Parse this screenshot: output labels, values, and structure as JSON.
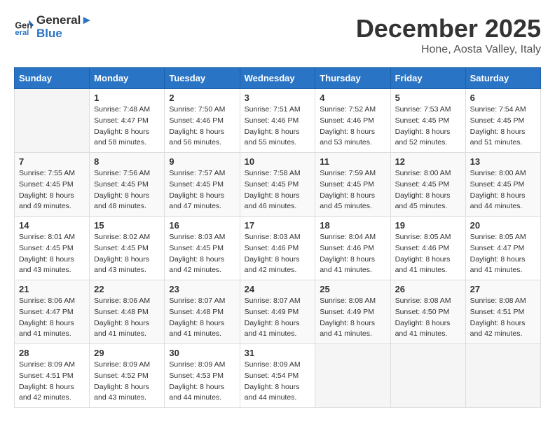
{
  "header": {
    "logo_line1": "General",
    "logo_line2": "Blue",
    "month": "December 2025",
    "location": "Hone, Aosta Valley, Italy"
  },
  "weekdays": [
    "Sunday",
    "Monday",
    "Tuesday",
    "Wednesday",
    "Thursday",
    "Friday",
    "Saturday"
  ],
  "weeks": [
    [
      {
        "day": "",
        "sunrise": "",
        "sunset": "",
        "daylight": ""
      },
      {
        "day": "1",
        "sunrise": "Sunrise: 7:48 AM",
        "sunset": "Sunset: 4:47 PM",
        "daylight": "Daylight: 8 hours and 58 minutes."
      },
      {
        "day": "2",
        "sunrise": "Sunrise: 7:50 AM",
        "sunset": "Sunset: 4:46 PM",
        "daylight": "Daylight: 8 hours and 56 minutes."
      },
      {
        "day": "3",
        "sunrise": "Sunrise: 7:51 AM",
        "sunset": "Sunset: 4:46 PM",
        "daylight": "Daylight: 8 hours and 55 minutes."
      },
      {
        "day": "4",
        "sunrise": "Sunrise: 7:52 AM",
        "sunset": "Sunset: 4:46 PM",
        "daylight": "Daylight: 8 hours and 53 minutes."
      },
      {
        "day": "5",
        "sunrise": "Sunrise: 7:53 AM",
        "sunset": "Sunset: 4:45 PM",
        "daylight": "Daylight: 8 hours and 52 minutes."
      },
      {
        "day": "6",
        "sunrise": "Sunrise: 7:54 AM",
        "sunset": "Sunset: 4:45 PM",
        "daylight": "Daylight: 8 hours and 51 minutes."
      }
    ],
    [
      {
        "day": "7",
        "sunrise": "Sunrise: 7:55 AM",
        "sunset": "Sunset: 4:45 PM",
        "daylight": "Daylight: 8 hours and 49 minutes."
      },
      {
        "day": "8",
        "sunrise": "Sunrise: 7:56 AM",
        "sunset": "Sunset: 4:45 PM",
        "daylight": "Daylight: 8 hours and 48 minutes."
      },
      {
        "day": "9",
        "sunrise": "Sunrise: 7:57 AM",
        "sunset": "Sunset: 4:45 PM",
        "daylight": "Daylight: 8 hours and 47 minutes."
      },
      {
        "day": "10",
        "sunrise": "Sunrise: 7:58 AM",
        "sunset": "Sunset: 4:45 PM",
        "daylight": "Daylight: 8 hours and 46 minutes."
      },
      {
        "day": "11",
        "sunrise": "Sunrise: 7:59 AM",
        "sunset": "Sunset: 4:45 PM",
        "daylight": "Daylight: 8 hours and 45 minutes."
      },
      {
        "day": "12",
        "sunrise": "Sunrise: 8:00 AM",
        "sunset": "Sunset: 4:45 PM",
        "daylight": "Daylight: 8 hours and 45 minutes."
      },
      {
        "day": "13",
        "sunrise": "Sunrise: 8:00 AM",
        "sunset": "Sunset: 4:45 PM",
        "daylight": "Daylight: 8 hours and 44 minutes."
      }
    ],
    [
      {
        "day": "14",
        "sunrise": "Sunrise: 8:01 AM",
        "sunset": "Sunset: 4:45 PM",
        "daylight": "Daylight: 8 hours and 43 minutes."
      },
      {
        "day": "15",
        "sunrise": "Sunrise: 8:02 AM",
        "sunset": "Sunset: 4:45 PM",
        "daylight": "Daylight: 8 hours and 43 minutes."
      },
      {
        "day": "16",
        "sunrise": "Sunrise: 8:03 AM",
        "sunset": "Sunset: 4:45 PM",
        "daylight": "Daylight: 8 hours and 42 minutes."
      },
      {
        "day": "17",
        "sunrise": "Sunrise: 8:03 AM",
        "sunset": "Sunset: 4:46 PM",
        "daylight": "Daylight: 8 hours and 42 minutes."
      },
      {
        "day": "18",
        "sunrise": "Sunrise: 8:04 AM",
        "sunset": "Sunset: 4:46 PM",
        "daylight": "Daylight: 8 hours and 41 minutes."
      },
      {
        "day": "19",
        "sunrise": "Sunrise: 8:05 AM",
        "sunset": "Sunset: 4:46 PM",
        "daylight": "Daylight: 8 hours and 41 minutes."
      },
      {
        "day": "20",
        "sunrise": "Sunrise: 8:05 AM",
        "sunset": "Sunset: 4:47 PM",
        "daylight": "Daylight: 8 hours and 41 minutes."
      }
    ],
    [
      {
        "day": "21",
        "sunrise": "Sunrise: 8:06 AM",
        "sunset": "Sunset: 4:47 PM",
        "daylight": "Daylight: 8 hours and 41 minutes."
      },
      {
        "day": "22",
        "sunrise": "Sunrise: 8:06 AM",
        "sunset": "Sunset: 4:48 PM",
        "daylight": "Daylight: 8 hours and 41 minutes."
      },
      {
        "day": "23",
        "sunrise": "Sunrise: 8:07 AM",
        "sunset": "Sunset: 4:48 PM",
        "daylight": "Daylight: 8 hours and 41 minutes."
      },
      {
        "day": "24",
        "sunrise": "Sunrise: 8:07 AM",
        "sunset": "Sunset: 4:49 PM",
        "daylight": "Daylight: 8 hours and 41 minutes."
      },
      {
        "day": "25",
        "sunrise": "Sunrise: 8:08 AM",
        "sunset": "Sunset: 4:49 PM",
        "daylight": "Daylight: 8 hours and 41 minutes."
      },
      {
        "day": "26",
        "sunrise": "Sunrise: 8:08 AM",
        "sunset": "Sunset: 4:50 PM",
        "daylight": "Daylight: 8 hours and 41 minutes."
      },
      {
        "day": "27",
        "sunrise": "Sunrise: 8:08 AM",
        "sunset": "Sunset: 4:51 PM",
        "daylight": "Daylight: 8 hours and 42 minutes."
      }
    ],
    [
      {
        "day": "28",
        "sunrise": "Sunrise: 8:09 AM",
        "sunset": "Sunset: 4:51 PM",
        "daylight": "Daylight: 8 hours and 42 minutes."
      },
      {
        "day": "29",
        "sunrise": "Sunrise: 8:09 AM",
        "sunset": "Sunset: 4:52 PM",
        "daylight": "Daylight: 8 hours and 43 minutes."
      },
      {
        "day": "30",
        "sunrise": "Sunrise: 8:09 AM",
        "sunset": "Sunset: 4:53 PM",
        "daylight": "Daylight: 8 hours and 44 minutes."
      },
      {
        "day": "31",
        "sunrise": "Sunrise: 8:09 AM",
        "sunset": "Sunset: 4:54 PM",
        "daylight": "Daylight: 8 hours and 44 minutes."
      },
      {
        "day": "",
        "sunrise": "",
        "sunset": "",
        "daylight": ""
      },
      {
        "day": "",
        "sunrise": "",
        "sunset": "",
        "daylight": ""
      },
      {
        "day": "",
        "sunrise": "",
        "sunset": "",
        "daylight": ""
      }
    ]
  ]
}
